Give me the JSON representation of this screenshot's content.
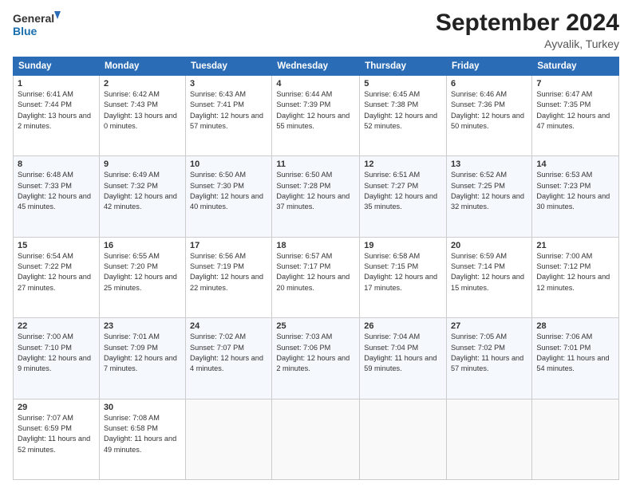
{
  "header": {
    "logo_line1": "General",
    "logo_line2": "Blue",
    "month": "September 2024",
    "location": "Ayvalik, Turkey"
  },
  "weekdays": [
    "Sunday",
    "Monday",
    "Tuesday",
    "Wednesday",
    "Thursday",
    "Friday",
    "Saturday"
  ],
  "weeks": [
    [
      {
        "day": "1",
        "sunrise": "6:41 AM",
        "sunset": "7:44 PM",
        "daylight": "13 hours and 2 minutes."
      },
      {
        "day": "2",
        "sunrise": "6:42 AM",
        "sunset": "7:43 PM",
        "daylight": "13 hours and 0 minutes."
      },
      {
        "day": "3",
        "sunrise": "6:43 AM",
        "sunset": "7:41 PM",
        "daylight": "12 hours and 57 minutes."
      },
      {
        "day": "4",
        "sunrise": "6:44 AM",
        "sunset": "7:39 PM",
        "daylight": "12 hours and 55 minutes."
      },
      {
        "day": "5",
        "sunrise": "6:45 AM",
        "sunset": "7:38 PM",
        "daylight": "12 hours and 52 minutes."
      },
      {
        "day": "6",
        "sunrise": "6:46 AM",
        "sunset": "7:36 PM",
        "daylight": "12 hours and 50 minutes."
      },
      {
        "day": "7",
        "sunrise": "6:47 AM",
        "sunset": "7:35 PM",
        "daylight": "12 hours and 47 minutes."
      }
    ],
    [
      {
        "day": "8",
        "sunrise": "6:48 AM",
        "sunset": "7:33 PM",
        "daylight": "12 hours and 45 minutes."
      },
      {
        "day": "9",
        "sunrise": "6:49 AM",
        "sunset": "7:32 PM",
        "daylight": "12 hours and 42 minutes."
      },
      {
        "day": "10",
        "sunrise": "6:50 AM",
        "sunset": "7:30 PM",
        "daylight": "12 hours and 40 minutes."
      },
      {
        "day": "11",
        "sunrise": "6:50 AM",
        "sunset": "7:28 PM",
        "daylight": "12 hours and 37 minutes."
      },
      {
        "day": "12",
        "sunrise": "6:51 AM",
        "sunset": "7:27 PM",
        "daylight": "12 hours and 35 minutes."
      },
      {
        "day": "13",
        "sunrise": "6:52 AM",
        "sunset": "7:25 PM",
        "daylight": "12 hours and 32 minutes."
      },
      {
        "day": "14",
        "sunrise": "6:53 AM",
        "sunset": "7:23 PM",
        "daylight": "12 hours and 30 minutes."
      }
    ],
    [
      {
        "day": "15",
        "sunrise": "6:54 AM",
        "sunset": "7:22 PM",
        "daylight": "12 hours and 27 minutes."
      },
      {
        "day": "16",
        "sunrise": "6:55 AM",
        "sunset": "7:20 PM",
        "daylight": "12 hours and 25 minutes."
      },
      {
        "day": "17",
        "sunrise": "6:56 AM",
        "sunset": "7:19 PM",
        "daylight": "12 hours and 22 minutes."
      },
      {
        "day": "18",
        "sunrise": "6:57 AM",
        "sunset": "7:17 PM",
        "daylight": "12 hours and 20 minutes."
      },
      {
        "day": "19",
        "sunrise": "6:58 AM",
        "sunset": "7:15 PM",
        "daylight": "12 hours and 17 minutes."
      },
      {
        "day": "20",
        "sunrise": "6:59 AM",
        "sunset": "7:14 PM",
        "daylight": "12 hours and 15 minutes."
      },
      {
        "day": "21",
        "sunrise": "7:00 AM",
        "sunset": "7:12 PM",
        "daylight": "12 hours and 12 minutes."
      }
    ],
    [
      {
        "day": "22",
        "sunrise": "7:00 AM",
        "sunset": "7:10 PM",
        "daylight": "12 hours and 9 minutes."
      },
      {
        "day": "23",
        "sunrise": "7:01 AM",
        "sunset": "7:09 PM",
        "daylight": "12 hours and 7 minutes."
      },
      {
        "day": "24",
        "sunrise": "7:02 AM",
        "sunset": "7:07 PM",
        "daylight": "12 hours and 4 minutes."
      },
      {
        "day": "25",
        "sunrise": "7:03 AM",
        "sunset": "7:06 PM",
        "daylight": "12 hours and 2 minutes."
      },
      {
        "day": "26",
        "sunrise": "7:04 AM",
        "sunset": "7:04 PM",
        "daylight": "11 hours and 59 minutes."
      },
      {
        "day": "27",
        "sunrise": "7:05 AM",
        "sunset": "7:02 PM",
        "daylight": "11 hours and 57 minutes."
      },
      {
        "day": "28",
        "sunrise": "7:06 AM",
        "sunset": "7:01 PM",
        "daylight": "11 hours and 54 minutes."
      }
    ],
    [
      {
        "day": "29",
        "sunrise": "7:07 AM",
        "sunset": "6:59 PM",
        "daylight": "11 hours and 52 minutes."
      },
      {
        "day": "30",
        "sunrise": "7:08 AM",
        "sunset": "6:58 PM",
        "daylight": "11 hours and 49 minutes."
      },
      null,
      null,
      null,
      null,
      null
    ]
  ]
}
